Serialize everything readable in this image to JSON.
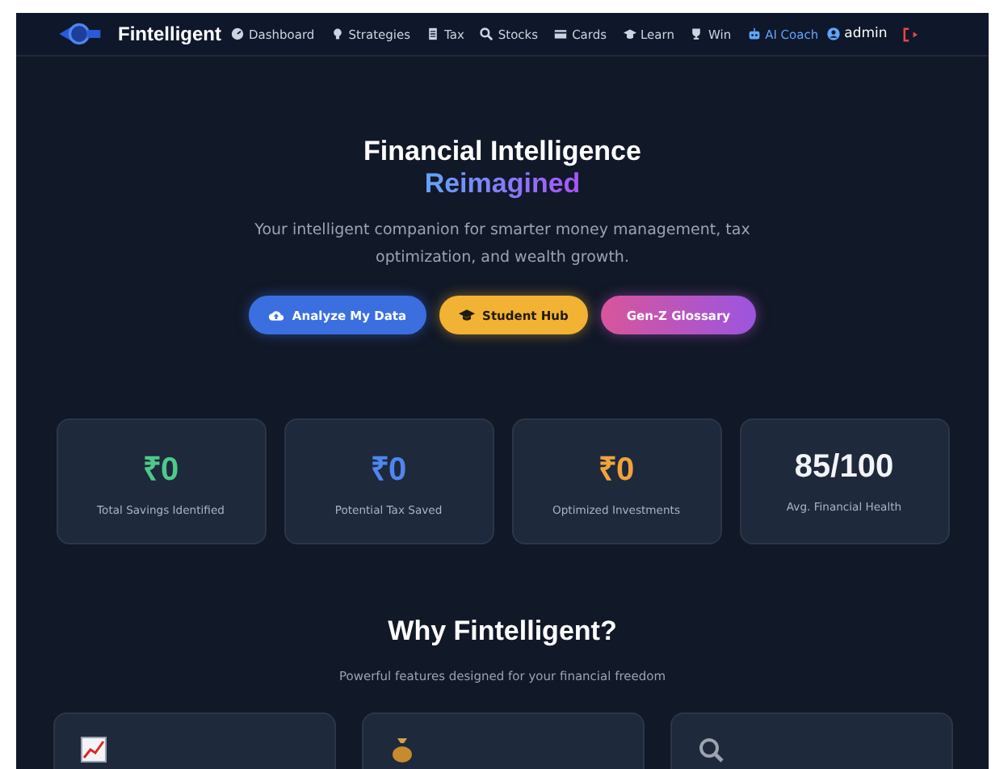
{
  "nav": {
    "brand": "Fintelligent",
    "items": [
      {
        "label": "Dashboard",
        "selected": false
      },
      {
        "label": "Strategies",
        "selected": false
      },
      {
        "label": "Tax",
        "selected": false
      },
      {
        "label": "Stocks",
        "selected": false
      },
      {
        "label": "Cards",
        "selected": false
      },
      {
        "label": "Learn",
        "selected": false
      },
      {
        "label": "Win",
        "selected": false
      },
      {
        "label": "AI Coach",
        "selected": true
      }
    ],
    "user": "admin"
  },
  "hero": {
    "title": "Financial Intelligence",
    "title_accent": "Reimagined",
    "subtitle": "Your intelligent companion for smarter money management, tax optimization, and wealth growth.",
    "buttons": [
      {
        "label": "Analyze My Data",
        "kind": "cloud"
      },
      {
        "label": "Student Hub",
        "kind": "cap"
      },
      {
        "label": "Gen-Z Glossary",
        "kind": "plain"
      }
    ]
  },
  "stats": [
    {
      "value": "₹0",
      "label": "Total Savings Identified",
      "color": "#4ec98a"
    },
    {
      "value": "₹0",
      "label": "Potential Tax Saved",
      "color": "#4f86f0"
    },
    {
      "value": "₹0",
      "label": "Optimized Investments",
      "color": "#f0a33c"
    },
    {
      "value": "85/100",
      "label": "Avg. Financial Health",
      "color": "#f2f4f8"
    }
  ],
  "why": {
    "title": "Why Fintelligent?",
    "subtitle": "Powerful features designed for your financial freedom",
    "features": [
      {
        "kind": "chart"
      },
      {
        "kind": "bag"
      },
      {
        "kind": "search"
      }
    ]
  }
}
